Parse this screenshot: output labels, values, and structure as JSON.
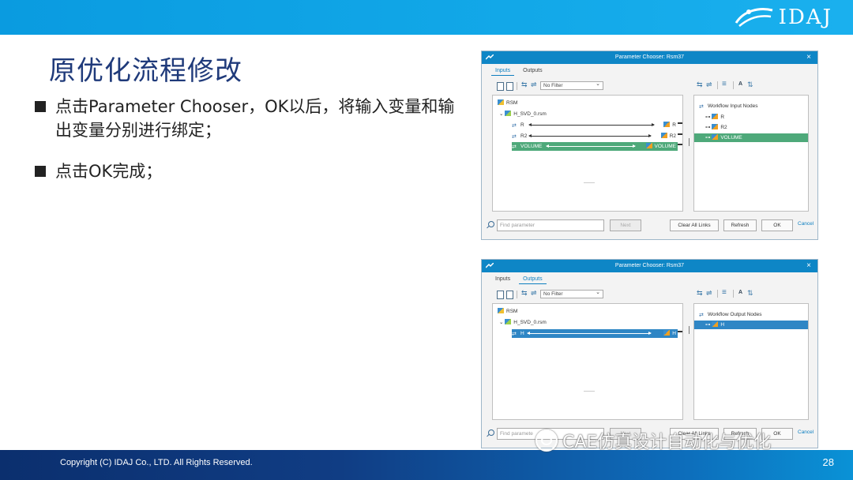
{
  "slide": {
    "title": "原优化流程修改",
    "bullets": [
      "点击Parameter Chooser，OK以后，将输入变量和输出变量分别进行绑定；",
      "点击OK完成；"
    ],
    "copyright": "Copyright (C)  IDAJ Co., LTD. All Rights Reserved.",
    "page_number": "28",
    "logo_text": "IDAJ",
    "watermark": "CAE仿真设计自动化与优化"
  },
  "dialog1": {
    "title": "Parameter Chooser: Rsm37",
    "tabs": [
      "Inputs",
      "Outputs"
    ],
    "active_tab": "Inputs",
    "filter": "No Filter",
    "tree_root": "RSM",
    "tree_file": "H_SVD_0.rsm",
    "rows": [
      {
        "left": "R",
        "right": "R"
      },
      {
        "left": "R2",
        "right": "R2"
      },
      {
        "left": "VOLUME",
        "right": "VOLUME"
      }
    ],
    "right_root": "Workflow Input Nodes",
    "right_items": [
      "R",
      "R2",
      "VOLUME"
    ],
    "find_placeholder": "Find parameter",
    "next": "Next",
    "clear_all_links": "Clear All Links",
    "refresh": "Refresh",
    "ok": "OK",
    "cancel": "Cancel"
  },
  "dialog2": {
    "title": "Parameter Chooser: Rsm37",
    "tabs": [
      "Inputs",
      "Outputs"
    ],
    "active_tab": "Outputs",
    "filter": "No Filter",
    "tree_root": "RSM",
    "tree_file": "H_SVD_0.rsm",
    "rows": [
      {
        "left": "H",
        "right": "H"
      }
    ],
    "right_root": "Workflow Output Nodes",
    "right_items": [
      "H"
    ],
    "find_placeholder": "Find paramete",
    "next": "Next",
    "clear_all_links": "Clear All Links",
    "refresh": "Refresh",
    "ok": "OK",
    "cancel": "Cancel"
  },
  "colors": {
    "topbar": "#12a8e8",
    "title": "#1f3a7a",
    "dialog_titlebar": "#0e86c6",
    "link_highlight": "#4ea97a",
    "selection_blue": "#2f86c5"
  }
}
